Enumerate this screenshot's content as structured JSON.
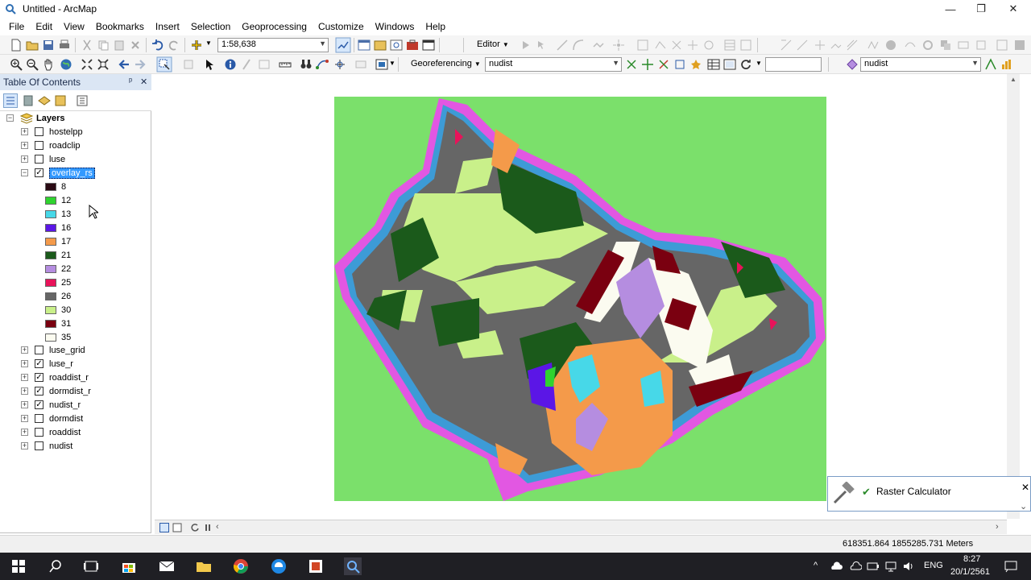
{
  "window": {
    "title": "Untitled - ArcMap",
    "minimize": "—",
    "restore": "❐",
    "close": "✕"
  },
  "menu": [
    "File",
    "Edit",
    "View",
    "Bookmarks",
    "Insert",
    "Selection",
    "Geoprocessing",
    "Customize",
    "Windows",
    "Help"
  ],
  "toolbar": {
    "scale": "1:58,638",
    "editor_label": "Editor",
    "georef_label": "Georeferencing",
    "georef_layer": "nudist",
    "spatial_layer": "nudist"
  },
  "toc": {
    "title": "Table Of Contents",
    "pin_glyph": "ᵖ",
    "close_glyph": "✕",
    "root": "Layers",
    "layers_top": [
      {
        "name": "hostelpp",
        "checked": false
      },
      {
        "name": "roadclip",
        "checked": false
      },
      {
        "name": "luse",
        "checked": false
      }
    ],
    "selected_layer": {
      "name": "overlay_rs",
      "checked": true
    },
    "legend": [
      {
        "value": "8",
        "color": "#2a0a14"
      },
      {
        "value": "12",
        "color": "#2fd32f"
      },
      {
        "value": "13",
        "color": "#47d8e8"
      },
      {
        "value": "16",
        "color": "#5b16e6"
      },
      {
        "value": "17",
        "color": "#f49a4a"
      },
      {
        "value": "21",
        "color": "#1b5a1b"
      },
      {
        "value": "22",
        "color": "#b58de0"
      },
      {
        "value": "25",
        "color": "#e8135a"
      },
      {
        "value": "26",
        "color": "#666666"
      },
      {
        "value": "30",
        "color": "#c9f08a"
      },
      {
        "value": "31",
        "color": "#7a0010"
      },
      {
        "value": "35",
        "color": "#fbfbf0"
      }
    ],
    "layers_bottom": [
      {
        "name": "luse_grid",
        "checked": false
      },
      {
        "name": "luse_r",
        "checked": true
      },
      {
        "name": "roaddist_r",
        "checked": true
      },
      {
        "name": "dormdist_r",
        "checked": true
      },
      {
        "name": "nudist_r",
        "checked": true
      },
      {
        "name": "dormdist",
        "checked": false
      },
      {
        "name": "roaddist",
        "checked": false
      },
      {
        "name": "nudist",
        "checked": false
      }
    ]
  },
  "status": {
    "coordinates": "618351.864  1855285.731 Meters"
  },
  "notification": {
    "title": "Raster Calculator",
    "close_glyph": "✕",
    "chevron_glyph": "⌄",
    "grip": "·········"
  },
  "taskbar": {
    "language": "ENG",
    "time": "8:27",
    "date": "20/1/2561"
  },
  "colors": {
    "background_green": "#7be06b",
    "buffer_pink": "#e257e2",
    "buffer_blue": "#3d9bd6",
    "accent": "#3399ff"
  }
}
